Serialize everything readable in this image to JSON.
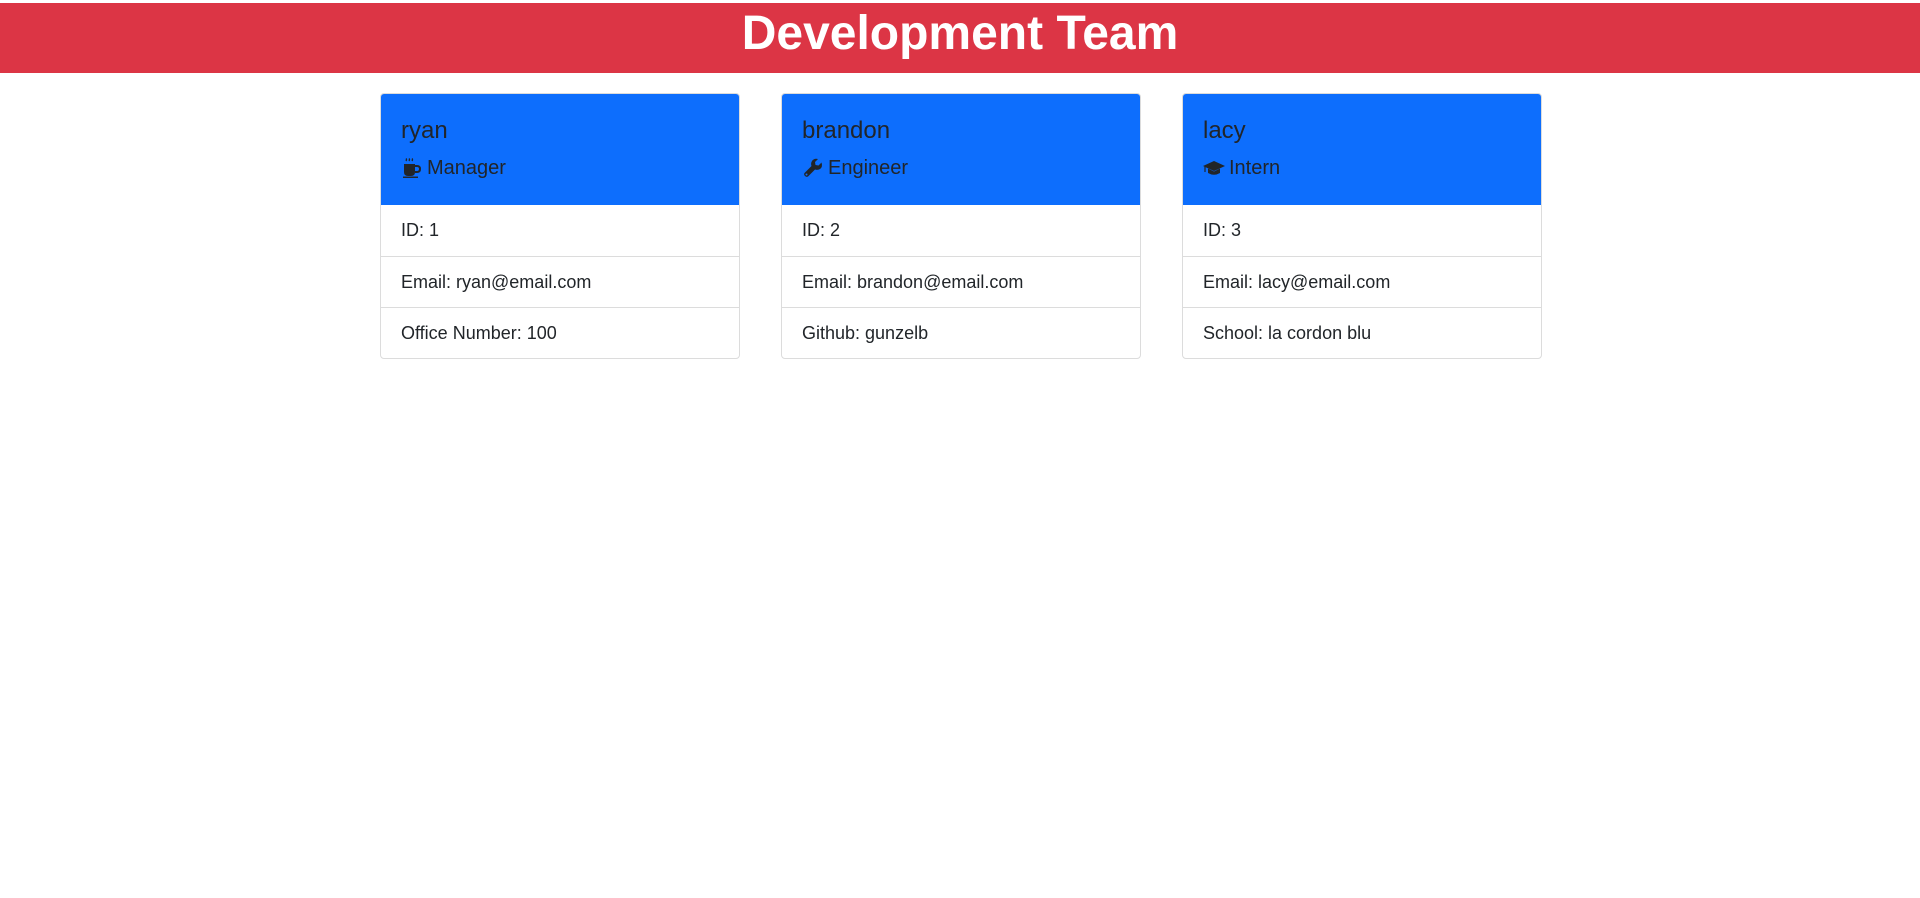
{
  "header": {
    "title": "Development Team"
  },
  "colors": {
    "header_bg": "#dc3545",
    "card_head_bg": "#0d6efd"
  },
  "cards": [
    {
      "name": "ryan",
      "role": "Manager",
      "role_icon": "coffee-mug-icon",
      "rows": [
        "ID: 1",
        "Email: ryan@email.com",
        "Office Number: 100"
      ]
    },
    {
      "name": "brandon",
      "role": "Engineer",
      "role_icon": "wrench-icon",
      "rows": [
        "ID: 2",
        "Email: brandon@email.com",
        "Github: gunzelb"
      ]
    },
    {
      "name": "lacy",
      "role": "Intern",
      "role_icon": "graduation-cap-icon",
      "rows": [
        "ID: 3",
        "Email: lacy@email.com",
        "School: la cordon blu"
      ]
    }
  ]
}
